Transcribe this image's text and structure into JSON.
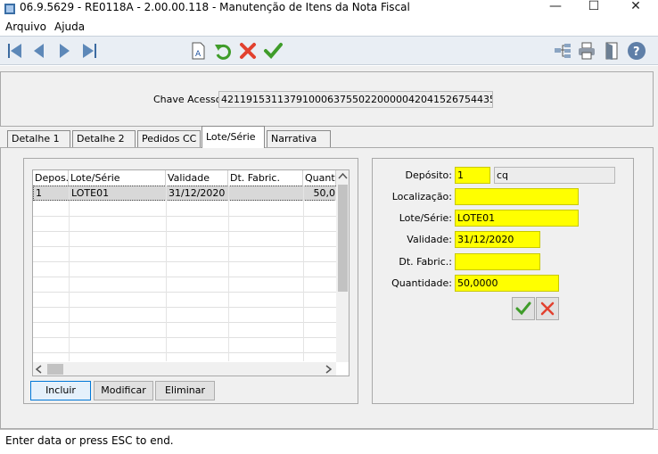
{
  "window": {
    "title": "06.9.5629 - RE0118A - 2.00.00.118 - Manutenção de Itens da Nota Fiscal",
    "controls": {
      "minimize": "—",
      "maximize": "☐",
      "close": "✕"
    }
  },
  "menu": {
    "items": [
      "Arquivo",
      "Ajuda"
    ]
  },
  "toolbar": {
    "icons": [
      "first-record-icon",
      "previous-record-icon",
      "next-record-icon",
      "last-record-icon",
      "zoom-document-icon",
      "undo-icon",
      "cancel-icon",
      "confirm-icon",
      "tree-icon",
      "print-icon",
      "exit-door-icon",
      "help-icon"
    ]
  },
  "header": {
    "chave_label": "Chave Acesso:",
    "chave_value": "42119153113791000637550220000042041526754435"
  },
  "tabs": [
    {
      "label": "Detalhe 1",
      "active": false
    },
    {
      "label": "Detalhe 2",
      "active": false
    },
    {
      "label": "Pedidos CC",
      "active": false
    },
    {
      "label": "Lote/Série",
      "active": true
    },
    {
      "label": "Narrativa",
      "active": false
    }
  ],
  "grid": {
    "columns": [
      "Depos.",
      "Lote/Série",
      "Validade",
      "Dt. Fabric.",
      "Quantid"
    ],
    "rows": [
      [
        "1",
        "LOTE01",
        "31/12/2020",
        "",
        "50,0"
      ]
    ]
  },
  "buttons": {
    "incluir": "Incluir",
    "modificar": "Modificar",
    "eliminar": "Eliminar"
  },
  "form": {
    "deposito_label": "Depósito:",
    "deposito_value": "1",
    "deposito_desc": "cq",
    "localizacao_label": "Localização:",
    "localizacao_value": "",
    "lote_label": "Lote/Série:",
    "lote_value": "LOTE01",
    "validade_label": "Validade:",
    "validade_value": "31/12/2020",
    "dtfabric_label": "Dt. Fabric.:",
    "dtfabric_value": "",
    "quantidade_label": "Quantidade:",
    "quantidade_value": "50,0000"
  },
  "status": {
    "text": "Enter data or press ESC to end."
  },
  "colors": {
    "required_field": "#ffff00",
    "toolbar_bg": "#e9eef4",
    "frame_bg": "#f0f0f0",
    "focus_border": "#0078d7"
  }
}
